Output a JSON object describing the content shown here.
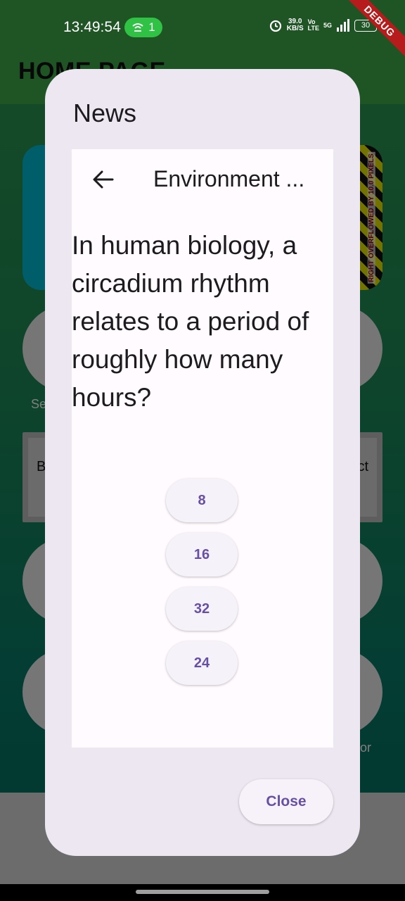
{
  "status_bar": {
    "time": "13:49:54",
    "hotspot_count": "1",
    "speed_value": "39.0",
    "speed_unit": "KB/S",
    "network_label_top": "Vo",
    "network_label_bottom": "LTE",
    "network_type": "5G",
    "battery": "30",
    "debug_banner": "DEBUG"
  },
  "background": {
    "app_title": "HOME PAGE",
    "overflow_warning": "RIGHT OVERFLOWED BY 10.0 PIXELS",
    "label_left": "Se",
    "box_left_text": "B",
    "box_right_text": "ct",
    "label_right": "or"
  },
  "dialog": {
    "title": "News",
    "inner_title": "Environment ...",
    "question": "In human biology, a circadium rhythm relates to a period of roughly how many hours?",
    "options": [
      "8",
      "16",
      "32",
      "24"
    ],
    "close_label": "Close"
  },
  "colors": {
    "dialog_bg": "#ece7f1",
    "accent": "#6750a4",
    "content_bg": "#fffbfe"
  },
  "icons": [
    "back-arrow-icon",
    "hotspot-icon",
    "alarm-icon",
    "signal-icon"
  ]
}
